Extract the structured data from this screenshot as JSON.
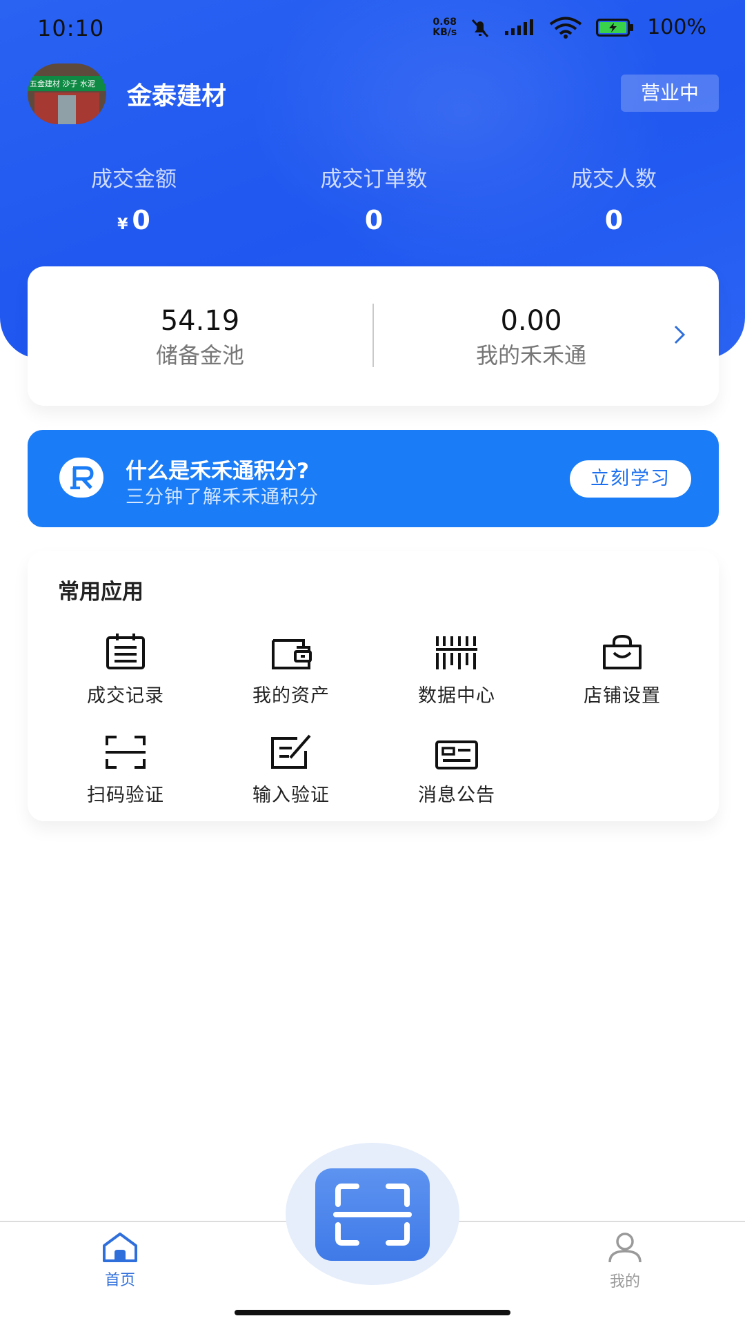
{
  "status_bar": {
    "time": "10:10",
    "net_speed_value": "0.68",
    "net_speed_unit": "KB/s",
    "battery_percent": "100%"
  },
  "store": {
    "name": "金泰建材",
    "avatar_sign": "五金建材 沙子 水泥",
    "status_badge": "营业中"
  },
  "stats": [
    {
      "label": "成交金额",
      "currency": "¥",
      "value": "0"
    },
    {
      "label": "成交订单数",
      "value": "0"
    },
    {
      "label": "成交人数",
      "value": "0"
    }
  ],
  "balance": {
    "reserve_value": "54.19",
    "reserve_label": "储备金池",
    "hehe_value": "0.00",
    "hehe_label": "我的禾禾通"
  },
  "promo": {
    "title": "什么是禾禾通积分?",
    "subtitle": "三分钟了解禾禾通积分",
    "button": "立刻学习"
  },
  "apps": {
    "title": "常用应用",
    "items": [
      {
        "label": "成交记录",
        "icon": "calendar-icon"
      },
      {
        "label": "我的资产",
        "icon": "wallet-icon"
      },
      {
        "label": "数据中心",
        "icon": "barcode-icon"
      },
      {
        "label": "店铺设置",
        "icon": "bag-icon"
      },
      {
        "label": "扫码验证",
        "icon": "scan-icon"
      },
      {
        "label": "输入验证",
        "icon": "edit-icon"
      },
      {
        "label": "消息公告",
        "icon": "id-card-icon"
      }
    ]
  },
  "nav": {
    "home": "首页",
    "mine": "我的"
  },
  "colors": {
    "primary": "#1f57f0",
    "banner": "#1a7cf6",
    "active_nav": "#2f6fdc",
    "inactive_nav": "#9a9a9a"
  }
}
